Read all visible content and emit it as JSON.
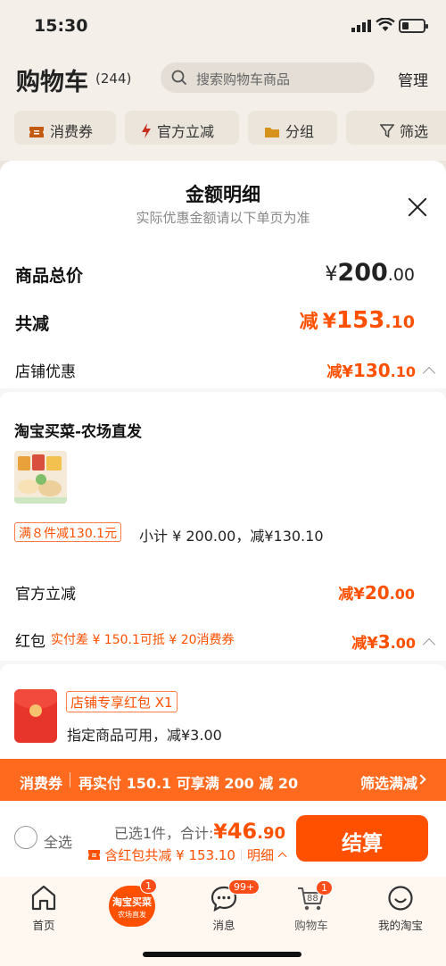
{
  "status_bar": {
    "time": "15:30"
  },
  "header": {
    "title": "购物车",
    "count": "(244)",
    "search_placeholder": "搜索购物车商品",
    "manage": "管理"
  },
  "filters": [
    {
      "label": "消费券",
      "icon": "ticket-icon"
    },
    {
      "label": "官方立减",
      "icon": "lightning-icon"
    },
    {
      "label": "分组",
      "icon": "folder-icon"
    },
    {
      "label": "筛选",
      "icon": "funnel-icon"
    }
  ],
  "sheet": {
    "title": "金额明细",
    "subtitle": "实际优惠金额请以下单页为准",
    "total_label": "商品总价",
    "total_symbol": "¥",
    "total_int": "200",
    "total_dec": ".00",
    "discount_label": "共减",
    "discount_prefix": "减",
    "discount_symbol": "¥",
    "discount_int": "153",
    "discount_dec": ".10",
    "store_label": "店铺优惠",
    "store_prefix": "减",
    "store_symbol": "¥",
    "store_int": "130",
    "store_dec": ".10",
    "shop_name": "淘宝买菜-农场直发",
    "promo_tag": "满８件减130.1元",
    "subtotal": "小计 ¥ 200.00，减¥130.10",
    "official_label": "官方立减",
    "official_prefix": "减",
    "official_symbol": "¥",
    "official_int": "20",
    "official_dec": ".00",
    "redpack_label": "红包",
    "redpack_note": "实付差 ¥ 150.1可抵 ¥ 20消费券",
    "redpack_prefix": "减",
    "redpack_symbol": "¥",
    "redpack_int": "3",
    "redpack_dec": ".00",
    "redpack_tag": "店铺专享红包 X1",
    "redpack_desc": "指定商品可用，减¥3.00"
  },
  "coupon_bar": {
    "label": "消费券",
    "message": "再实付 150.1 可享满 200 减 20",
    "action": "筛选满减"
  },
  "checkout": {
    "select_all": "全选",
    "selected_text": "已选1件，合计:",
    "amount_symbol": "¥",
    "amount_int": "46",
    "amount_dec": ".90",
    "redpack_total": "含红包共减 ¥ 153.10",
    "detail": "明细",
    "pay_button": "结算"
  },
  "tabbar": {
    "home": "首页",
    "center_line1": "淘宝买菜",
    "center_line2": "农场直发",
    "center_badge": "1",
    "messages": "消息",
    "messages_badge": "99+",
    "cart": "购物车",
    "cart_badge": "1",
    "cart_icon_number": "88",
    "mine": "我的淘宝"
  }
}
